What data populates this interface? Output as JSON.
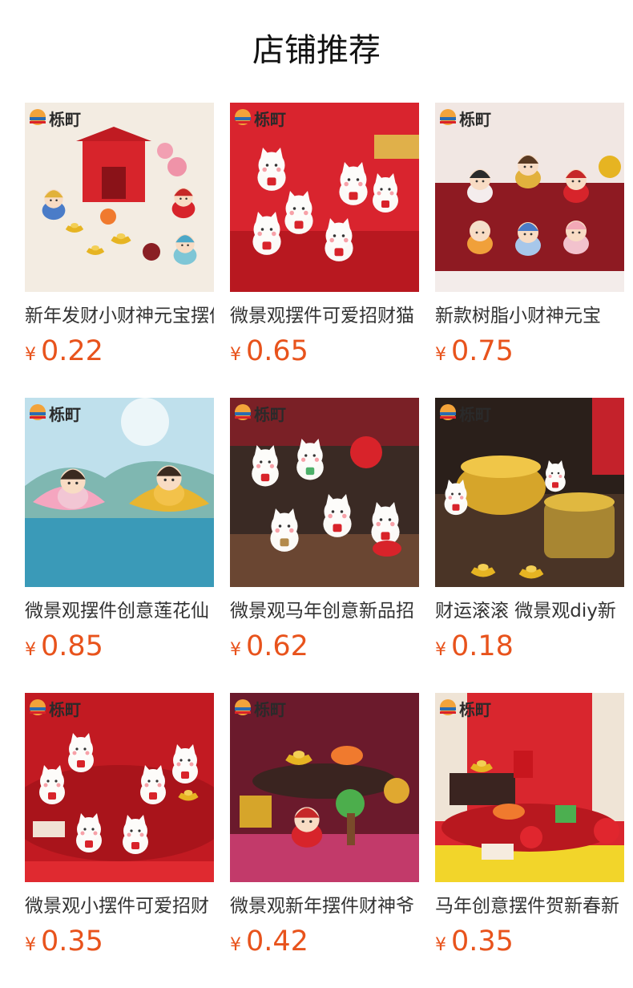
{
  "header": {
    "title": "店铺推荐"
  },
  "products": [
    {
      "title": "新年发财小财神元宝摆件",
      "currency": "¥",
      "price": "0.22",
      "theme": "shrine",
      "logo": "栎町"
    },
    {
      "title": "微景观摆件可爱招财猫",
      "currency": "¥",
      "price": "0.65",
      "theme": "cats-red",
      "logo": "栎町"
    },
    {
      "title": "新款树脂小财神元宝",
      "currency": "¥",
      "price": "0.75",
      "theme": "gods",
      "logo": "栎町"
    },
    {
      "title": "微景观摆件创意莲花仙",
      "currency": "¥",
      "price": "0.85",
      "theme": "lotus",
      "logo": "栎町"
    },
    {
      "title": "微景观马年创意新品招",
      "currency": "¥",
      "price": "0.62",
      "theme": "cats-dark",
      "logo": "栎町"
    },
    {
      "title": "财运滚滚 微景观diy新",
      "currency": "¥",
      "price": "0.18",
      "theme": "gold",
      "logo": "栎町"
    },
    {
      "title": "微景观小摆件可爱招财",
      "currency": "¥",
      "price": "0.35",
      "theme": "cats-stage",
      "logo": "栎町"
    },
    {
      "title": "微景观新年摆件财神爷",
      "currency": "¥",
      "price": "0.42",
      "theme": "caishen",
      "logo": "栎町"
    },
    {
      "title": "马年创意摆件贺新春新",
      "currency": "¥",
      "price": "0.35",
      "theme": "yellow-stage",
      "logo": "栎町"
    }
  ]
}
